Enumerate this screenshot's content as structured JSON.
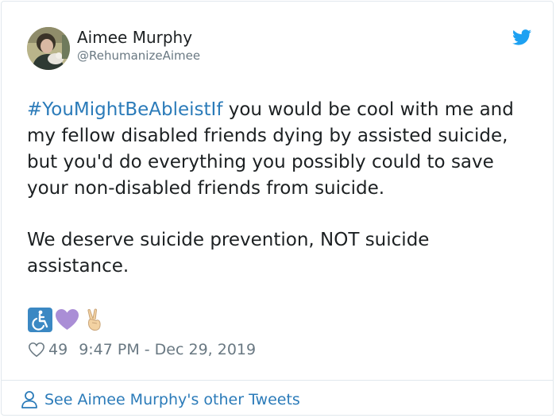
{
  "tweet": {
    "author": {
      "display_name": "Aimee Murphy",
      "handle": "@RehumanizeAimee"
    },
    "text": {
      "hashtag": "#YouMightBeAbleistIf",
      "line1_rest": " you would be cool with me and my fellow disabled friends dying by assisted suicide, but you'd do everything you possibly could to save your non-disabled friends from suicide.",
      "paragraph2": "We deserve suicide prevention, NOT suicide assistance."
    },
    "emojis": [
      "wheelchair-symbol-emoji",
      "purple-heart-emoji",
      "victory-hand-emoji"
    ],
    "likes": "49",
    "timestamp": "9:47 PM - Dec 29, 2019"
  },
  "footer": {
    "link_label": "See Aimee Murphy's other Tweets"
  },
  "colors": {
    "link": "#2b7bb9",
    "text": "#1c2022",
    "muted": "#697882",
    "twitter_blue": "#1da1f2",
    "border": "#e1e8ed"
  }
}
